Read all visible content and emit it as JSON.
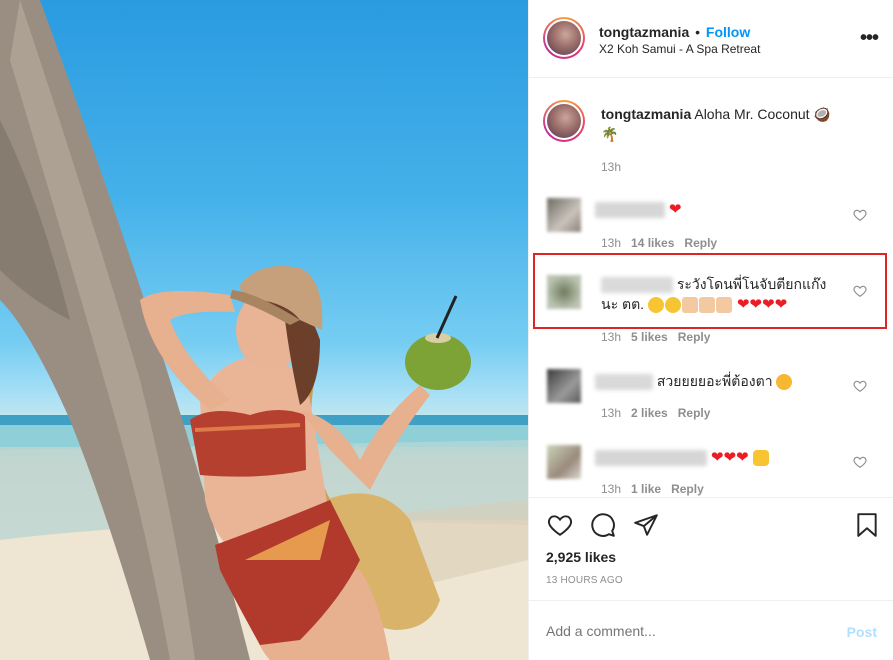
{
  "post": {
    "username": "tongtazmania",
    "separator": "•",
    "follow_label": "Follow",
    "location": "X2 Koh Samui - A Spa Retreat",
    "more_icon": "more-options-icon"
  },
  "caption": {
    "username": "tongtazmania",
    "text": "Aloha Mr. Coconut 🥥",
    "text_line2": "🌴",
    "time": "13h"
  },
  "comments": [
    {
      "text": "",
      "hearts": "❤",
      "time": "13h",
      "likes": "14 likes",
      "reply": "Reply"
    },
    {
      "text": "ระวังโดนพี่โนจับตียกแก๊ง",
      "text_line2": "นะ ตต.",
      "time": "13h",
      "likes": "5 likes",
      "reply": "Reply",
      "highlighted": true
    },
    {
      "text": "สวยยยยอะพี่ต้องตา",
      "time": "13h",
      "likes": "2 likes",
      "reply": "Reply"
    },
    {
      "text": "",
      "time": "13h",
      "likes": "1 like",
      "reply": "Reply"
    }
  ],
  "stats": {
    "likes": "2,925 likes",
    "time_ago": "13 HOURS AGO"
  },
  "add_comment": {
    "placeholder": "Add a comment...",
    "post_label": "Post"
  },
  "colors": {
    "accent": "#0095f6",
    "highlight_box": "#e02424",
    "heart_red": "#ed1c24"
  },
  "icons": [
    "like-icon",
    "comment-icon",
    "share-icon",
    "bookmark-icon",
    "heart-outline-icon"
  ]
}
